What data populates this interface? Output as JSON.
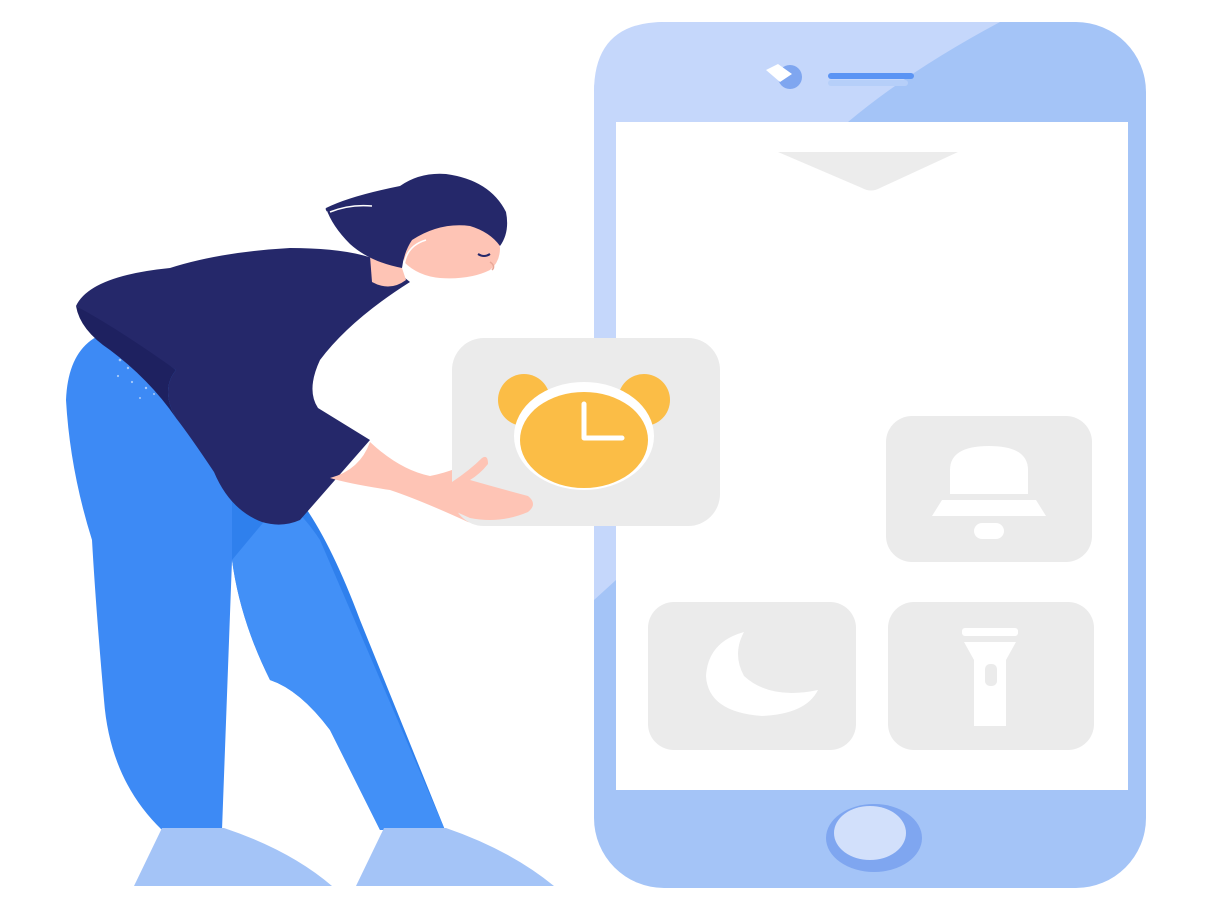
{
  "illustration": {
    "kind": "flat vector illustration: woman placing an alarm-clock app tile onto a smartphone screen",
    "palette": {
      "phone_body": "#a4c4f7",
      "phone_body_light": "#c5d7fb",
      "screen": "#ffffff",
      "tile": "#ebebeb",
      "tile_icon": "#ffffff",
      "alarm_clock": "#fbbd46",
      "hair_and_shirt": "#25286a",
      "skin": "#fec4b5",
      "pants": "#3d8af5",
      "shoes": "#a4c4f7",
      "home_button": "#d2e0fb"
    },
    "phone": {
      "app_tiles": [
        {
          "icon": "alarm-clock-icon",
          "state": "held-by-person"
        },
        {
          "icon": "bell-icon",
          "state": "on-screen"
        },
        {
          "icon": "moon-icon",
          "state": "on-screen"
        },
        {
          "icon": "flashlight-icon",
          "state": "on-screen"
        }
      ],
      "top_bar_icons": [
        "camera-icon",
        "speaker-slot"
      ],
      "screen_indicator": "chevron-down-icon"
    }
  }
}
